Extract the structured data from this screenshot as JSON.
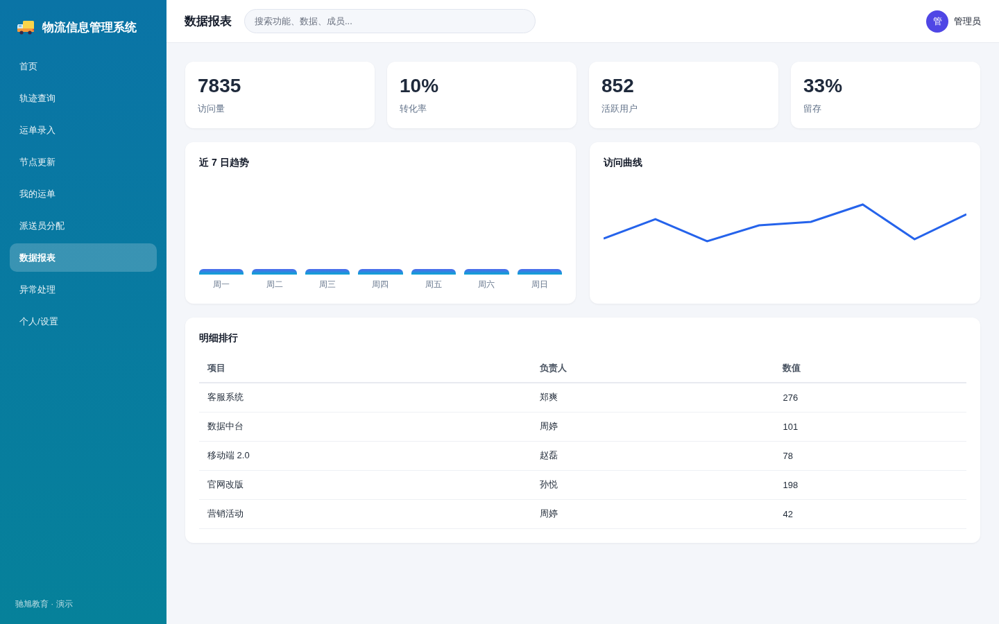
{
  "sidebar": {
    "brand": "物流信息管理系统",
    "items": [
      {
        "label": "首页",
        "selected": false
      },
      {
        "label": "轨迹查询",
        "selected": false
      },
      {
        "label": "运单录入",
        "selected": false
      },
      {
        "label": "节点更新",
        "selected": false
      },
      {
        "label": "我的运单",
        "selected": false
      },
      {
        "label": "派送员分配",
        "selected": false
      },
      {
        "label": "数据报表",
        "selected": true
      },
      {
        "label": "异常处理",
        "selected": false
      },
      {
        "label": "个人/设置",
        "selected": false
      }
    ],
    "footer": "驰旭教育 · 演示"
  },
  "header": {
    "title": "数据报表",
    "search": {
      "placeholder": "搜索功能、数据、成员..."
    },
    "user": {
      "avatar": "管",
      "name": "管理员"
    }
  },
  "stats": [
    {
      "value": "7835",
      "label": "访问量"
    },
    {
      "value": "10%",
      "label": "转化率"
    },
    {
      "value": "852",
      "label": "活跃用户"
    },
    {
      "value": "33%",
      "label": "留存"
    }
  ],
  "trend_chart": {
    "title": "近 7 日趋势",
    "days": [
      "周一",
      "周二",
      "周三",
      "周四",
      "周五",
      "周六",
      "周日"
    ]
  },
  "visit_chart": {
    "title": "访问曲线"
  },
  "table": {
    "title": "明细排行",
    "columns": [
      "项目",
      "负责人",
      "数值"
    ],
    "rows": [
      [
        "客服系统",
        "郑爽",
        "276"
      ],
      [
        "数据中台",
        "周婷",
        "101"
      ],
      [
        "移动端 2.0",
        "赵磊",
        "78"
      ],
      [
        "官网改版",
        "孙悦",
        "198"
      ],
      [
        "营销活动",
        "周婷",
        "42"
      ]
    ]
  }
}
